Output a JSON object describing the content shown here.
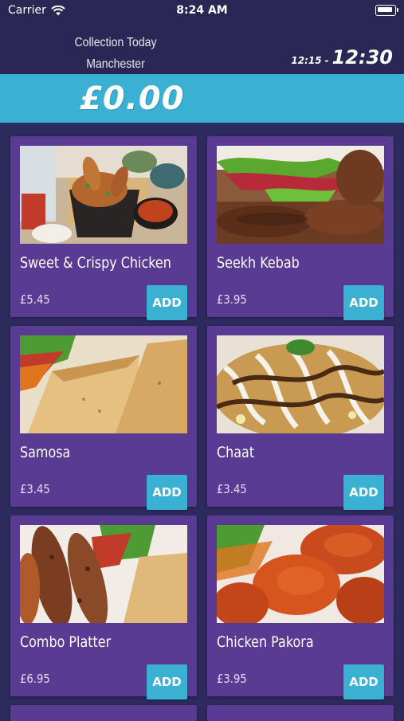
{
  "status_bar": {
    "carrier": "Carrier",
    "time": "8:24 AM",
    "wifi_icon": "wifi-icon",
    "battery_icon": "battery-icon"
  },
  "header": {
    "collection_line": "Collection Today",
    "location": "Manchester",
    "slot_from": "12:15",
    "slot_dash": "-",
    "slot_to": "12:30"
  },
  "basket": {
    "total": "£0.00"
  },
  "menu_items": [
    {
      "name": "Sweet & Crispy Chicken",
      "price": "£5.45",
      "add_label": "ADD"
    },
    {
      "name": "Seekh Kebab",
      "price": "£3.95",
      "add_label": "ADD"
    },
    {
      "name": "Samosa",
      "price": "£3.45",
      "add_label": "ADD"
    },
    {
      "name": "Chaat",
      "price": "£3.45",
      "add_label": "ADD"
    },
    {
      "name": "Combo Platter",
      "price": "£6.95",
      "add_label": "ADD"
    },
    {
      "name": "Chicken Pakora",
      "price": "£3.95",
      "add_label": "ADD"
    }
  ],
  "colors": {
    "background": "#2d2a5e",
    "header": "#2a2755",
    "accent": "#3ab0d3",
    "card": "#5a3b94"
  }
}
